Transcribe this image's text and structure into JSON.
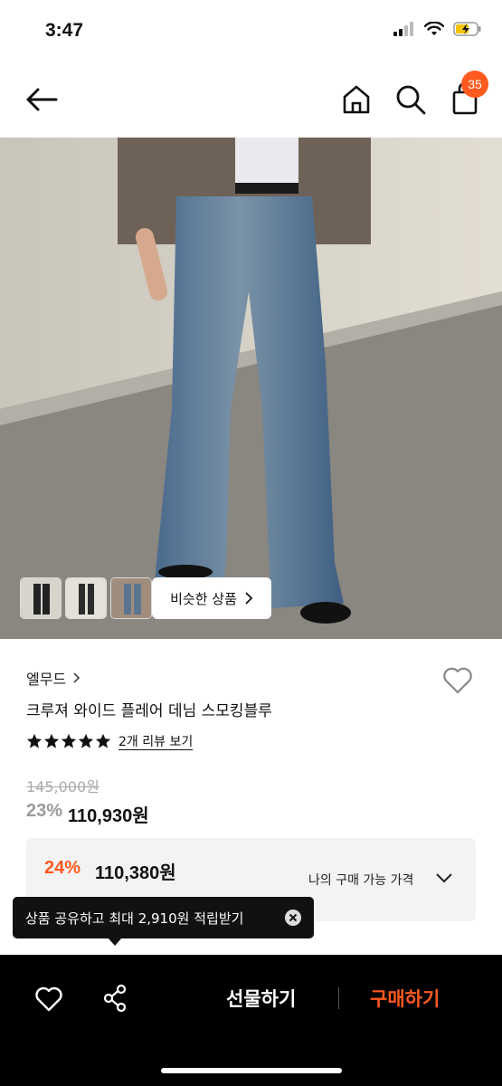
{
  "status_bar": {
    "time": "3:47",
    "icons": [
      "cellular-signal-icon",
      "wifi-icon",
      "battery-charging-icon"
    ]
  },
  "nav": {
    "icons": [
      "back-arrow-icon",
      "home-icon",
      "search-icon",
      "cart-icon"
    ],
    "cart_badge": "35"
  },
  "gallery": {
    "similar_button": "비슷한 상품",
    "thumbnail_count": 3
  },
  "product": {
    "brand": "엘무드",
    "name": "크루져 와이드 플레어 데님 스모킹블루",
    "rating_stars": 5,
    "review_link": "2개 리뷰 보기",
    "original_price": "145,000원",
    "discount": "23%",
    "price": "110,930원"
  },
  "my_price": {
    "discount": "24%",
    "price": "110,380원",
    "label": "나의 구매 가능 가격"
  },
  "toast": {
    "text": "상품 공유하고 최대 2,910원 적립받기"
  },
  "bottom_bar": {
    "gift_label": "선물하기",
    "buy_label": "구매하기"
  },
  "colors": {
    "accent": "#ff5a1f",
    "bottom_bar_bg": "#000000"
  }
}
